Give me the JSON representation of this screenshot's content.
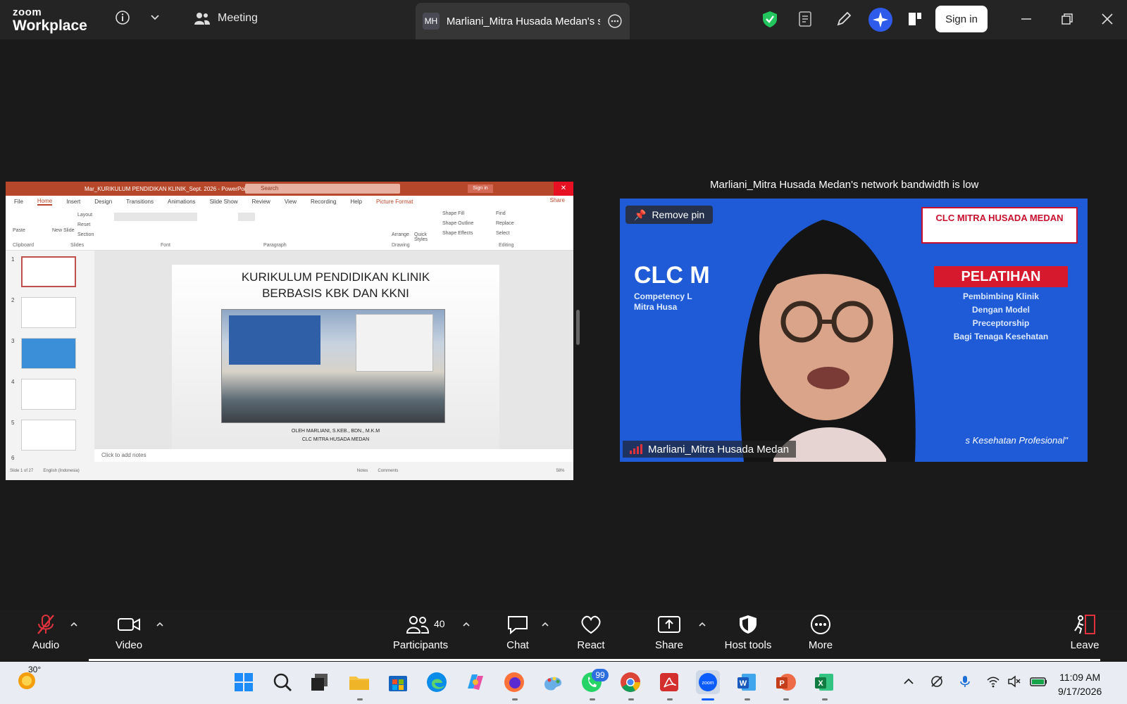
{
  "titlebar": {
    "brand_top": "zoom",
    "brand_bottom": "Workplace",
    "meeting_label": "Meeting",
    "tab_initials": "MH",
    "tab_title": "Marliani_Mitra Husada Medan's sc",
    "sign_in": "Sign in"
  },
  "ppt": {
    "title": "Mar_KURIKULUM PENDIDIKAN KLINIK_Sept. 2026 - PowerPoint",
    "search_placeholder": "Search",
    "sign_in": "Sign in",
    "menu": [
      "File",
      "Home",
      "Insert",
      "Design",
      "Transitions",
      "Animations",
      "Slide Show",
      "Review",
      "View",
      "Recording",
      "Help",
      "Picture Format"
    ],
    "share": "Share",
    "ribbon_groups": [
      "Clipboard",
      "Slides",
      "Font",
      "Paragraph",
      "Drawing",
      "Editing"
    ],
    "ribbon_buttons": [
      "Paste",
      "New Slide",
      "Layout",
      "Reset",
      "Section",
      "Arrange",
      "Quick Styles",
      "Shape Fill",
      "Shape Outline",
      "Shape Effects",
      "Find",
      "Replace",
      "Select"
    ],
    "thumb_numbers": [
      "1",
      "2",
      "3",
      "4",
      "5",
      "6"
    ],
    "slide_title_1": "KURIKULUM PENDIDIKAN KLINIK",
    "slide_title_2": "BERBASIS KBK DAN KKNI",
    "slide_by_1": "OLEH MARLIANI, S.KEB., BDN., M.K.M",
    "slide_by_2": "CLC MITRA HUSADA MEDAN",
    "notes_placeholder": "Click to add notes",
    "status_slide": "Slide 1 of 27",
    "status_lang": "English (Indonesia)",
    "status_notes": "Notes",
    "status_comments": "Comments",
    "zoom": "58%"
  },
  "video": {
    "bandwidth_msg": "Marliani_Mitra Husada Medan's network bandwidth is low",
    "remove_pin": "Remove pin",
    "participant_name": "Marliani_Mitra Husada Medan",
    "clc_heading": "CLC M",
    "clc_sub_1": "Competency L",
    "clc_sub_2": "Mitra Husa",
    "badge_text": "CLC MITRA HUSADA MEDAN",
    "pelatihan": "PELATIHAN",
    "pel_desc": [
      "Pembimbing Klinik",
      "Dengan Model",
      "Preceptorship",
      "Bagi Tenaga Kesehatan"
    ],
    "tagline": "s Kesehatan Profesional\""
  },
  "toolbar": {
    "audio": "Audio",
    "video": "Video",
    "participants": "Participants",
    "participant_count": "40",
    "chat": "Chat",
    "react": "React",
    "share": "Share",
    "host_tools": "Host tools",
    "more": "More",
    "leave": "Leave"
  },
  "taskbar": {
    "temperature": "30°",
    "whatsapp_badge": "99",
    "time": "11:09 AM",
    "date": "9/17/2026"
  },
  "colors": {
    "ppt_accent": "#b7472a",
    "zoom_blue": "#0b5cff",
    "leave_red": "#e0323c",
    "video_bg": "#1f5bd6"
  }
}
